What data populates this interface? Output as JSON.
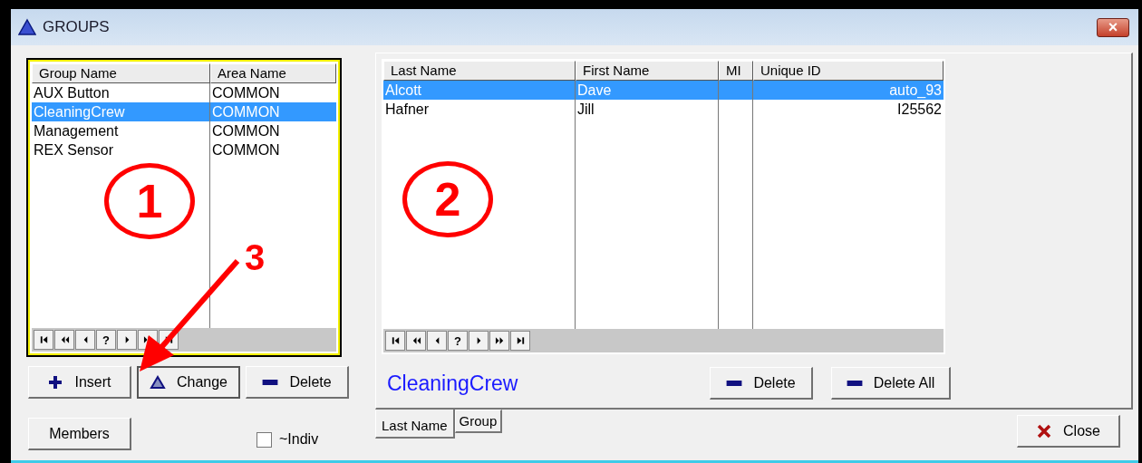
{
  "window": {
    "title": "GROUPS",
    "close": "×"
  },
  "groups_grid": {
    "columns": [
      "Group Name",
      "Area Name"
    ],
    "rows": [
      {
        "cells": [
          "AUX Button",
          "COMMON"
        ],
        "selected": false
      },
      {
        "cells": [
          "CleaningCrew",
          "COMMON"
        ],
        "selected": true
      },
      {
        "cells": [
          "Management",
          "COMMON"
        ],
        "selected": false
      },
      {
        "cells": [
          "REX Sensor",
          "COMMON"
        ],
        "selected": false
      }
    ],
    "navigator": [
      {
        "kind": "first"
      },
      {
        "kind": "prior-page"
      },
      {
        "kind": "prior"
      },
      {
        "kind": "query",
        "label": "?"
      },
      {
        "kind": "next"
      },
      {
        "kind": "next-page"
      },
      {
        "kind": "last"
      }
    ]
  },
  "group_buttons": [
    {
      "kind": "insert",
      "label": "Insert"
    },
    {
      "kind": "change",
      "label": "Change"
    },
    {
      "kind": "delete",
      "label": "Delete"
    }
  ],
  "members_button": "Members",
  "indiv_checkbox": {
    "label": "~Indiv",
    "checked": false
  },
  "members_grid": {
    "columns": [
      "Last Name",
      "First Name",
      "MI",
      "Unique ID"
    ],
    "rows": [
      {
        "cells": [
          "Alcott",
          "Dave",
          "",
          "auto_93"
        ],
        "selected": true
      },
      {
        "cells": [
          "Hafner",
          "Jill",
          "",
          "I25562"
        ],
        "selected": false
      }
    ],
    "navigator": [
      {
        "kind": "first"
      },
      {
        "kind": "prior-page"
      },
      {
        "kind": "prior"
      },
      {
        "kind": "query",
        "label": "?"
      },
      {
        "kind": "next"
      },
      {
        "kind": "next-page"
      },
      {
        "kind": "last"
      }
    ]
  },
  "current_group": "CleaningCrew",
  "member_buttons": [
    {
      "kind": "delete",
      "label": "Delete"
    },
    {
      "kind": "delete",
      "label": "Delete All"
    }
  ],
  "tabs": [
    {
      "label": "Last Name",
      "selected": true
    },
    {
      "label": "Group",
      "selected": false
    }
  ],
  "close_button": "Close",
  "annotations": [
    {
      "kind": "circle",
      "label": "1"
    },
    {
      "kind": "circle",
      "label": "2"
    },
    {
      "kind": "arrow",
      "label": "3"
    }
  ]
}
